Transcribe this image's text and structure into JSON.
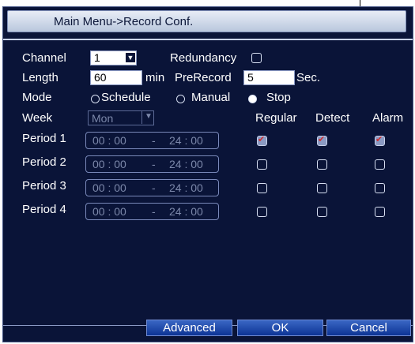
{
  "title": "Main Menu->Record Conf.",
  "channel": {
    "label": "Channel",
    "value": "1"
  },
  "redundancy": {
    "label": "Redundancy",
    "checked": false
  },
  "length": {
    "label": "Length",
    "value": "60",
    "unit": "min"
  },
  "prerecord": {
    "label": "PreRecord",
    "value": "5",
    "unit": "Sec."
  },
  "mode": {
    "label": "Mode",
    "options": [
      {
        "label": "Schedule",
        "selected": false
      },
      {
        "label": "Manual",
        "selected": false
      },
      {
        "label": "Stop",
        "selected": true
      }
    ]
  },
  "week": {
    "label": "Week",
    "value": "Mon"
  },
  "columns": {
    "regular": "Regular",
    "detect": "Detect",
    "alarm": "Alarm"
  },
  "periods": [
    {
      "label": "Period 1",
      "start": "00 : 00",
      "dash": "-",
      "end": "24 : 00",
      "regular": true,
      "detect": true,
      "alarm": true
    },
    {
      "label": "Period 2",
      "start": "00 : 00",
      "dash": "-",
      "end": "24 : 00",
      "regular": false,
      "detect": false,
      "alarm": false
    },
    {
      "label": "Period 3",
      "start": "00 : 00",
      "dash": "-",
      "end": "24 : 00",
      "regular": false,
      "detect": false,
      "alarm": false
    },
    {
      "label": "Period 4",
      "start": "00 : 00",
      "dash": "-",
      "end": "24 : 00",
      "regular": false,
      "detect": false,
      "alarm": false
    }
  ],
  "buttons": {
    "advanced": "Advanced",
    "ok": "OK",
    "cancel": "Cancel"
  },
  "colors": {
    "background": "#0a1438",
    "button": "#1c48b0",
    "check_mark": "#d03030"
  }
}
